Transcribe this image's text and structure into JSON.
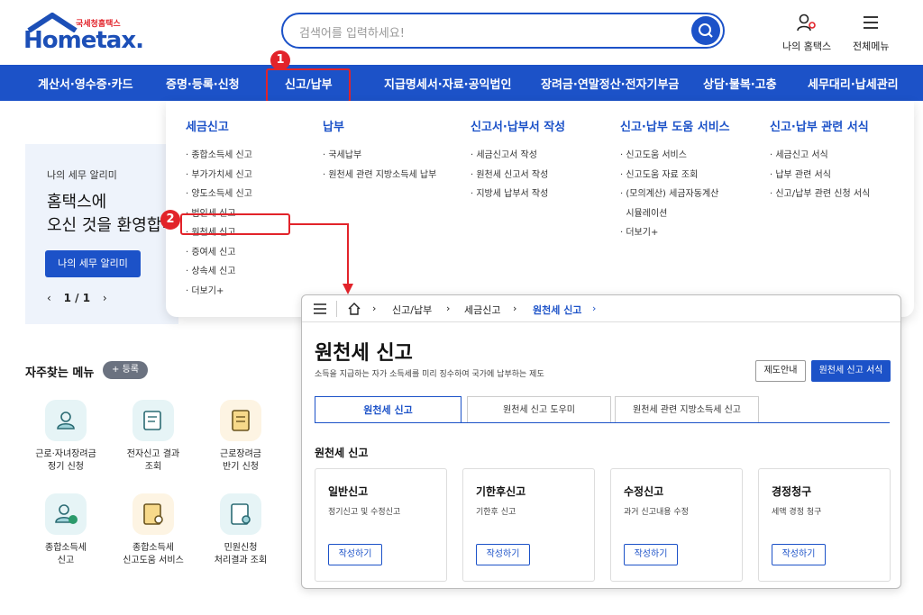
{
  "header": {
    "logo_small": "국세청홈택스",
    "logo_big": "Hometax.",
    "search_placeholder": "검색어를 입력하세요!",
    "my_hometax": "나의 홈택스",
    "all_menu": "전체메뉴"
  },
  "nav": {
    "items": [
      "계산서·영수증·카드",
      "증명·등록·신청",
      "신고/납부",
      "지급명세서·자료·공익법인",
      "장려금·연말정산·전자기부금",
      "상담·불복·고충",
      "세무대리·납세관리"
    ]
  },
  "badges": {
    "one": "1",
    "two": "2"
  },
  "welcome": {
    "label": "나의 세무 알리미",
    "line1": "홈택스에",
    "line2": "오신 것을 환영합니",
    "button": "나의 세무 알리미",
    "pager": "1 / 1"
  },
  "mega": {
    "columns": [
      {
        "head": "세금신고",
        "items": [
          "· 종합소득세 신고",
          "· 부가가치세 신고",
          "· 양도소득세 신고",
          "· 법인세 신고",
          "· 원천세 신고",
          "· 증여세 신고",
          "· 상속세 신고",
          "· 더보기+"
        ]
      },
      {
        "head": "납부",
        "items": [
          "· 국세납부",
          "· 원천세 관련 지방소득세 납부"
        ]
      },
      {
        "head": "신고서·납부서 작성",
        "items": [
          "· 세금신고서 작성",
          "· 원천세 신고서 작성",
          "· 지방세 납부서 작성"
        ]
      },
      {
        "head": "신고·납부 도움 서비스",
        "items": [
          "· 신고도움 서비스",
          "· 신고도움 자료 조회",
          "· (모의계산) 세금자동계산",
          "  시뮬레이션",
          "· 더보기+"
        ]
      },
      {
        "head": "신고·납부 관련 서식",
        "items": [
          "· 세금신고 서식",
          "· 납부 관련 서식",
          "· 신고/납부 관련 신청 서식"
        ]
      }
    ]
  },
  "quick_menu": {
    "title": "자주찾는 메뉴",
    "add": "+ 등록",
    "items": [
      {
        "line1": "근로·자녀장려금",
        "line2": "정기 신청",
        "color": "#e6f4f6"
      },
      {
        "line1": "전자신고 결과",
        "line2": "조회",
        "color": "#e6f4f6"
      },
      {
        "line1": "근로장려금",
        "line2": "반기 신청",
        "color": "#fdf4e3"
      },
      {
        "line1": "종합소득세",
        "line2": "신고",
        "color": "#e6f4f6"
      },
      {
        "line1": "종합소득세",
        "line2": "신고도움 서비스",
        "color": "#fdf4e3"
      },
      {
        "line1": "민원신청",
        "line2": "처리결과 조회",
        "color": "#e6f4f6"
      }
    ]
  },
  "inset": {
    "breadcrumbs": [
      "신고/납부",
      "세금신고",
      "원천세 신고"
    ],
    "title": "원천세 신고",
    "desc": "소득을 지급하는 자가 소득세를 미리 징수하여 국가에 납부하는 제도",
    "btn_info": "제도안내",
    "btn_form": "원천세 신고 서식",
    "tabs": [
      "원천세 신고",
      "원천세 신고 도우미",
      "원천세 관련 지방소득세 신고"
    ],
    "section": "원천세 신고",
    "cards": [
      {
        "title": "일반신고",
        "desc": "정기신고 및 수정신고",
        "btn": "작성하기"
      },
      {
        "title": "기한후신고",
        "desc": "기한후 신고",
        "btn": "작성하기"
      },
      {
        "title": "수정신고",
        "desc": "과거 신고내용 수정",
        "btn": "작성하기"
      },
      {
        "title": "경정청구",
        "desc": "세액 경정 청구",
        "btn": "작성하기"
      }
    ]
  },
  "colors": {
    "brand": "#1c52c8",
    "highlight": "#e2232a"
  }
}
